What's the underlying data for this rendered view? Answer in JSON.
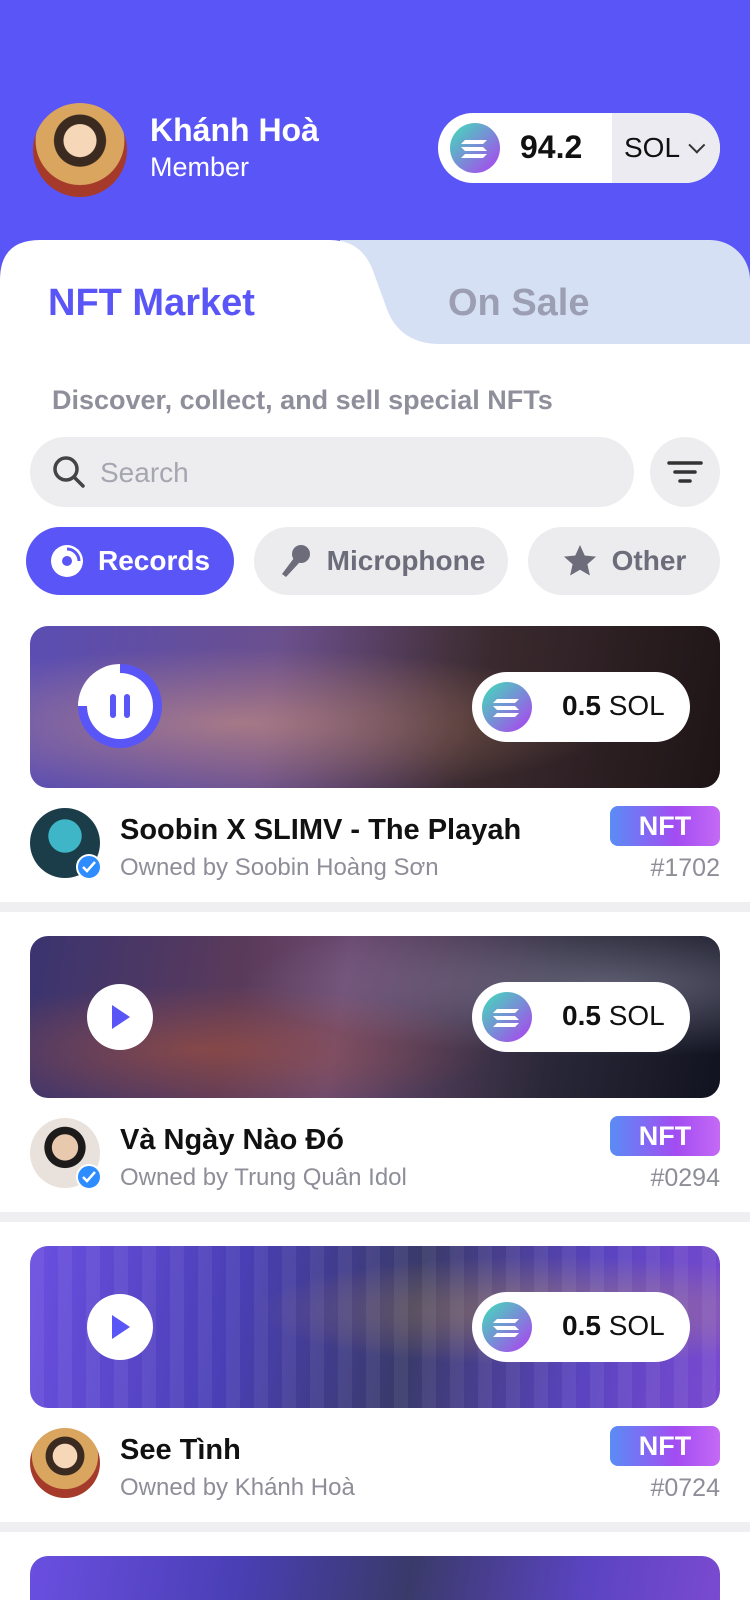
{
  "user": {
    "name": "Khánh Hoà",
    "role": "Member"
  },
  "wallet": {
    "amount": "94.2",
    "currency": "SOL"
  },
  "tabs": [
    {
      "label": "NFT Market",
      "active": true
    },
    {
      "label": "On Sale",
      "active": false
    }
  ],
  "subtitle": "Discover, collect, and sell special NFTs",
  "search": {
    "placeholder": "Search"
  },
  "categories": [
    {
      "label": "Records",
      "icon": "record-icon",
      "active": true
    },
    {
      "label": "Microphone",
      "icon": "microphone-icon",
      "active": false
    },
    {
      "label": "Other",
      "icon": "star-icon",
      "active": false
    }
  ],
  "items": [
    {
      "title": "Soobin X SLIMV - The Playah",
      "owner": "Owned by Soobin Hoàng Sơn",
      "badge": "NFT",
      "id": "#1702",
      "price_value": "0.5",
      "price_unit": "SOL",
      "state": "playing",
      "verified": true
    },
    {
      "title": "Và Ngày Nào Đó",
      "owner": "Owned by Trung Quân Idol",
      "badge": "NFT",
      "id": "#0294",
      "price_value": "0.5",
      "price_unit": "SOL",
      "state": "paused",
      "verified": true
    },
    {
      "title": "See Tình",
      "owner": "Owned by Khánh Hoà",
      "badge": "NFT",
      "id": "#0724",
      "price_value": "0.5",
      "price_unit": "SOL",
      "state": "paused",
      "verified": false
    }
  ],
  "colors": {
    "accent": "#5a55f6",
    "tab_inactive_bg": "#d6e0f4",
    "muted_text": "#8e8e99"
  }
}
